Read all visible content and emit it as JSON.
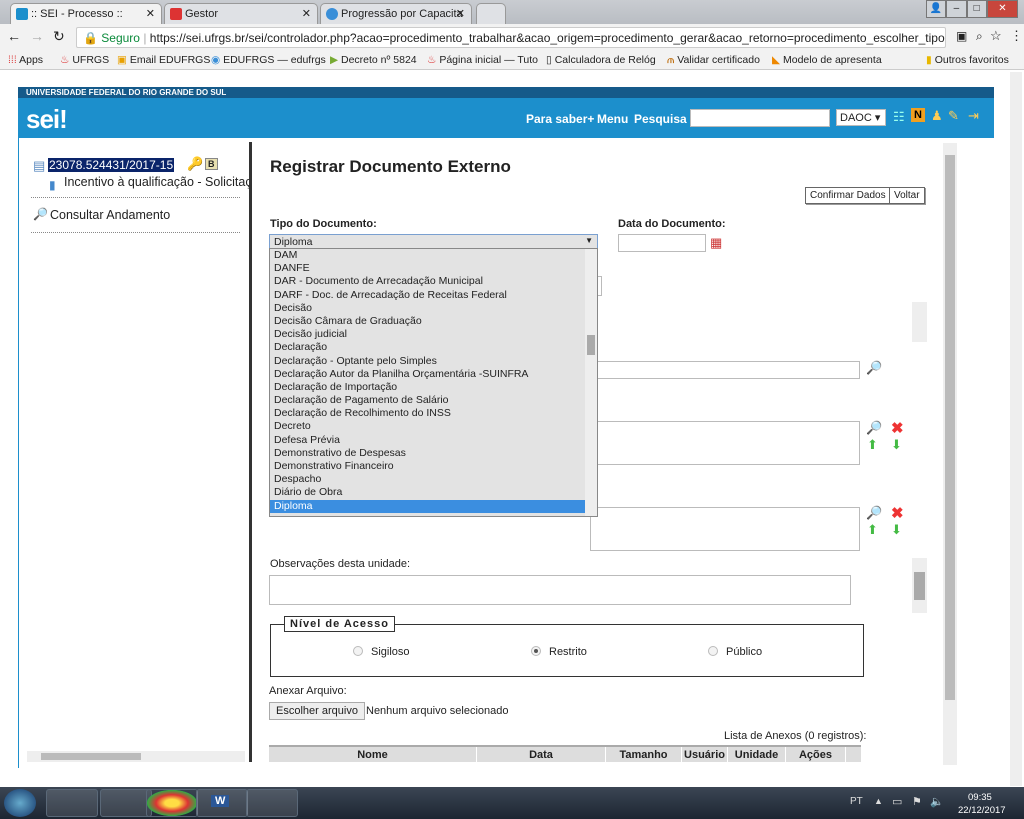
{
  "browser": {
    "tabs": [
      {
        "label": ":: SEI - Processo ::",
        "active": true
      },
      {
        "label": "Gestor"
      },
      {
        "label": "Progressão por Capacita"
      }
    ],
    "secure_label": "Seguro",
    "url": "https://sei.ufrgs.br/sei/controlador.php?acao=procedimento_trabalhar&acao_origem=procedimento_gerar&acao_retorno=procedimento_escolher_tipo&id_p...",
    "bookmarks": [
      "Apps",
      "UFRGS",
      "Email EDUFRGS",
      "EDUFRGS — edufrgs",
      "Decreto nº 5824",
      "Página inicial — Tuto",
      "Calculadora de Relóg",
      "Validar certificado",
      "Modelo de apresenta"
    ],
    "other_bookmarks": "Outros favoritos"
  },
  "header": {
    "institution": "UNIVERSIDADE FEDERAL DO RIO GRANDE DO SUL",
    "logo": "sei!",
    "links": [
      "Para saber+",
      "Menu",
      "Pesquisa"
    ],
    "unit_select": "DAOC",
    "brand_color": "#1c8fcc"
  },
  "tree": {
    "process_number": "23078.524431/2017-15",
    "badge": "B",
    "document": "Incentivo à qualificação - Solicitação",
    "consult": "Consultar Andamento"
  },
  "form": {
    "title": "Registrar Documento Externo",
    "confirm_button": "Confirmar Dados",
    "back_button": "Voltar",
    "tipo_label": "Tipo do Documento:",
    "tipo_value": "Diploma",
    "data_label": "Data do Documento:",
    "data_value": "",
    "dropdown_options": [
      "DAM",
      "DANFE",
      "DAR - Documento de Arrecadação Municipal",
      "DARF - Doc. de Arrecadação de Receitas Federal",
      "Decisão",
      "Decisão Câmara de Graduação",
      "Decisão judicial",
      "Declaração",
      "Declaração - Optante pelo Simples",
      "Declaração Autor da Planilha Orçamentária -SUINFRA",
      "Declaração de Importação",
      "Declaração de Pagamento de Salário",
      "Declaração de Recolhimento do INSS",
      "Decreto",
      "Defesa Prévia",
      "Demonstrativo de Despesas",
      "Demonstrativo Financeiro",
      "Despacho",
      "Diário de Obra",
      "Diploma"
    ],
    "selected_option": "Diploma",
    "obs_label": "Observações desta unidade:",
    "access_legend": "Nível de Acesso",
    "access_options": [
      {
        "label": "Sigiloso",
        "checked": false
      },
      {
        "label": "Restrito",
        "checked": true
      },
      {
        "label": "Público",
        "checked": false
      }
    ],
    "attach_label": "Anexar Arquivo:",
    "choose_file": "Escolher arquivo",
    "no_file": "Nenhum arquivo selecionado",
    "attachments_caption": "Lista de Anexos (0 registros):",
    "columns": [
      "Nome",
      "Data",
      "Tamanho",
      "Usuário",
      "Unidade",
      "Ações"
    ]
  },
  "taskbar": {
    "lang": "PT",
    "time": "09:35",
    "date": "22/12/2017"
  }
}
